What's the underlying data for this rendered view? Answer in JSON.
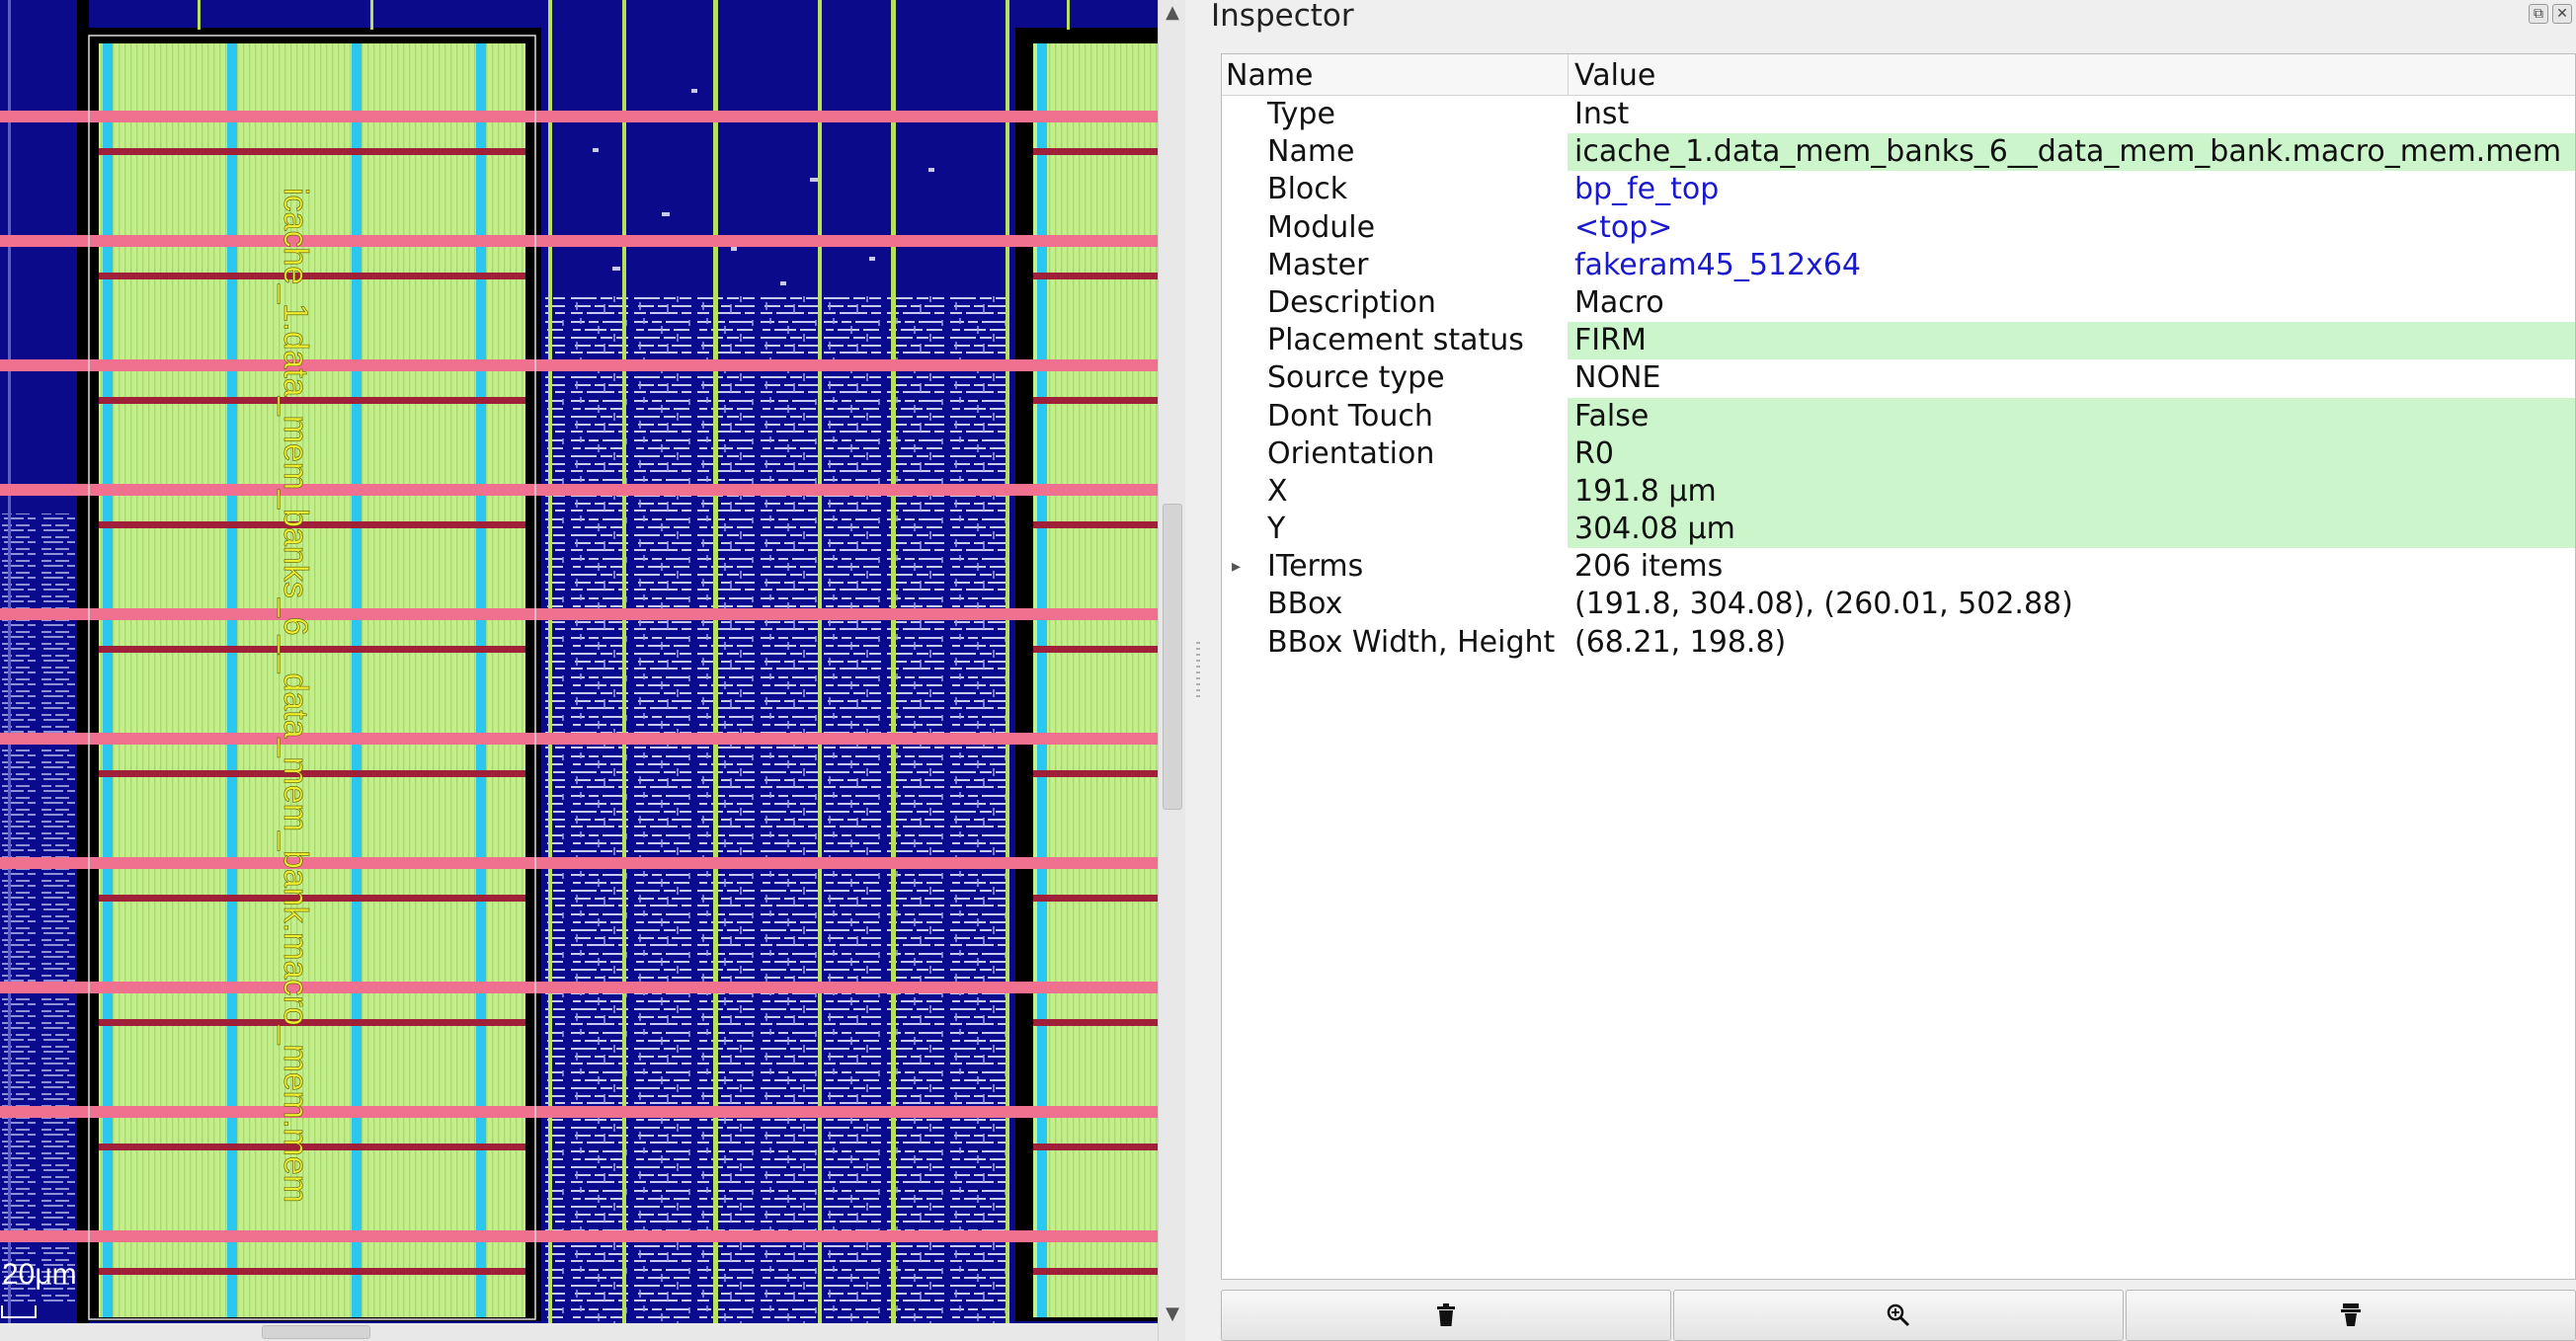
{
  "layout": {
    "instance_label": "icache_1.data_mem_banks_6__data_mem_bank.macro_mem.mem",
    "scale_label": "20μm"
  },
  "inspector": {
    "title": "Inspector",
    "columns": {
      "name": "Name",
      "value": "Value"
    },
    "rows": [
      {
        "name": "Type",
        "value": "Inst",
        "style": "plain"
      },
      {
        "name": "Name",
        "value": "icache_1.data_mem_banks_6__data_mem_bank.macro_mem.mem",
        "style": "editable"
      },
      {
        "name": "Block",
        "value": "bp_fe_top",
        "style": "link"
      },
      {
        "name": "Module",
        "value": "<top>",
        "style": "link"
      },
      {
        "name": "Master",
        "value": "fakeram45_512x64",
        "style": "link"
      },
      {
        "name": "Description",
        "value": "Macro",
        "style": "plain"
      },
      {
        "name": "Placement status",
        "value": "FIRM",
        "style": "editable"
      },
      {
        "name": "Source type",
        "value": "NONE",
        "style": "plain"
      },
      {
        "name": "Dont Touch",
        "value": "False",
        "style": "editable"
      },
      {
        "name": "Orientation",
        "value": "R0",
        "style": "editable"
      },
      {
        "name": "X",
        "value": "191.8 μm",
        "style": "editable"
      },
      {
        "name": "Y",
        "value": "304.08 μm",
        "style": "editable"
      },
      {
        "name": "ITerms",
        "value": "206 items",
        "style": "plain",
        "expandable": true
      },
      {
        "name": "BBox",
        "value": "(191.8, 304.08), (260.01, 502.88)",
        "style": "plain"
      },
      {
        "name": "BBox Width, Height",
        "value": "(68.21, 198.8)",
        "style": "plain"
      }
    ],
    "buttons": [
      {
        "icon": "trash-icon"
      },
      {
        "icon": "zoom-icon"
      },
      {
        "icon": "highlight-icon"
      }
    ]
  }
}
